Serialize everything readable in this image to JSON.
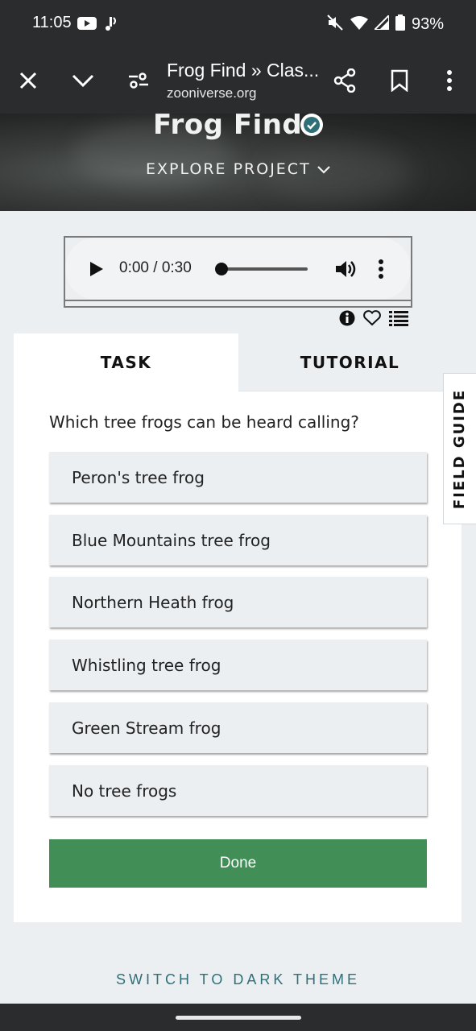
{
  "status_bar": {
    "time": "11:05",
    "battery": "93%",
    "icons": [
      "youtube-icon",
      "notification-icon",
      "mute-icon",
      "wifi-icon",
      "signal-icon",
      "battery-icon"
    ]
  },
  "browser": {
    "page_title": "Frog Find » Clas...",
    "url": "zooniverse.org",
    "icons": [
      "close-icon",
      "chevron-down-icon",
      "site-settings-icon",
      "share-icon",
      "bookmark-icon",
      "more-vert-icon"
    ]
  },
  "hero": {
    "project_title": "Frog Find",
    "explore_label": "EXPLORE PROJECT"
  },
  "audio": {
    "time_display": "0:00 / 0:30",
    "progress": 0.0
  },
  "subject_actions": [
    "info-icon",
    "favorite-icon",
    "collections-icon"
  ],
  "tabs": {
    "task": "TASK",
    "tutorial": "TUTORIAL"
  },
  "task": {
    "question": "Which tree frogs can be heard calling?",
    "answers": [
      "Peron's tree frog",
      "Blue Mountains tree frog",
      "Northern Heath frog",
      "Whistling tree frog",
      "Green Stream frog",
      "No tree frogs"
    ],
    "done_label": "Done"
  },
  "field_guide_label": "FIELD GUIDE",
  "theme_switch_label": "SWITCH TO DARK THEME",
  "colors": {
    "status_bar_bg": "#2b2c2e",
    "page_bg": "#ebeff2",
    "done_button": "#418f57",
    "theme_link": "#2f6f77",
    "verified_badge": "#2f6f77"
  }
}
